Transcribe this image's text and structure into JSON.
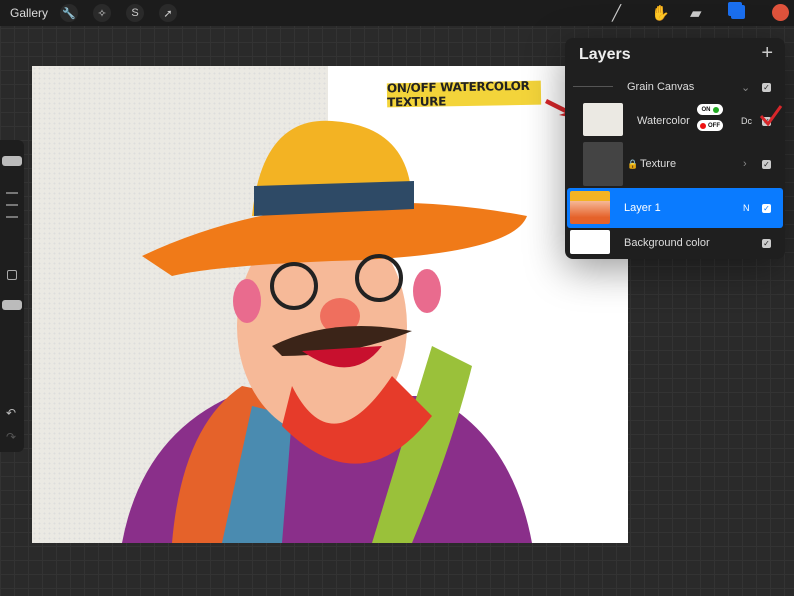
{
  "topbar": {
    "gallery": "Gallery",
    "left_icons": [
      "wrench-icon",
      "magic-wand-icon",
      "selection-icon",
      "transform-arrow-icon"
    ],
    "right_icons": [
      "brush-icon",
      "smudge-icon",
      "eraser-icon",
      "layers-icon",
      "color-swatch"
    ],
    "color": "#e0533c",
    "layers_accent": "#1a6ff0"
  },
  "annotation": {
    "banner": "ON/OFF WATERCOLOR TEXTURE"
  },
  "layers": {
    "title": "Layers",
    "add": "+",
    "items": [
      {
        "name": "Grain Canvas",
        "mode": "",
        "checked": true
      },
      {
        "name": "Watercolor",
        "mode": "Dc",
        "checked": true,
        "on": "ON",
        "off": "OFF"
      },
      {
        "name": "Texture",
        "mode": "",
        "checked": true,
        "locked": true
      },
      {
        "name": "Layer 1",
        "mode": "N",
        "checked": true,
        "selected": true
      },
      {
        "name": "Background color",
        "mode": "",
        "checked": true
      }
    ]
  }
}
